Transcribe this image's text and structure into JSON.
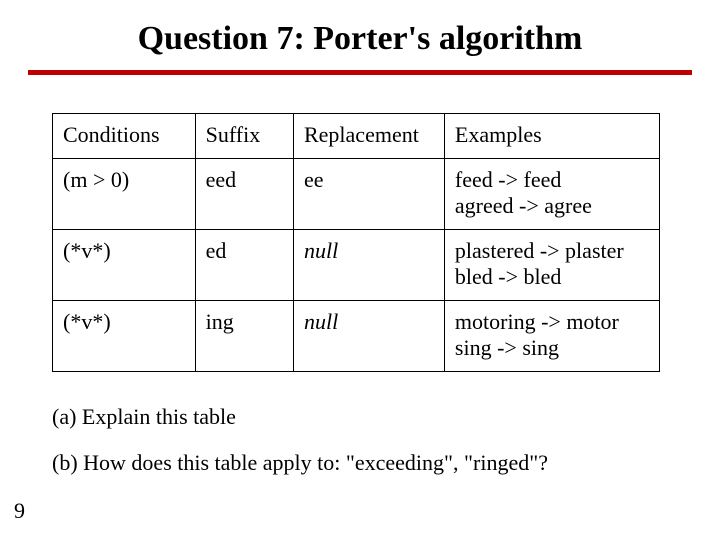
{
  "title": "Question 7: Porter's algorithm",
  "table": {
    "headers": {
      "conditions": "Conditions",
      "suffix": "Suffix",
      "replacement": "Replacement",
      "examples": "Examples"
    },
    "rows": [
      {
        "condition": "(m > 0)",
        "suffix": "eed",
        "replacement": "ee",
        "replacement_italic": false,
        "example_line1": "feed -> feed",
        "example_line2": "agreed -> agree"
      },
      {
        "condition": "(*v*)",
        "suffix": "ed",
        "replacement": "null",
        "replacement_italic": true,
        "example_line1": "plastered -> plaster",
        "example_line2": "bled -> bled"
      },
      {
        "condition": "(*v*)",
        "suffix": "ing",
        "replacement": "null",
        "replacement_italic": true,
        "example_line1": "motoring -> motor",
        "example_line2": "sing -> sing"
      }
    ]
  },
  "questions": {
    "a": "(a)  Explain this table",
    "b": "(b)  How does this table apply to: \"exceeding\", \"ringed\"?"
  },
  "page_number": "9"
}
